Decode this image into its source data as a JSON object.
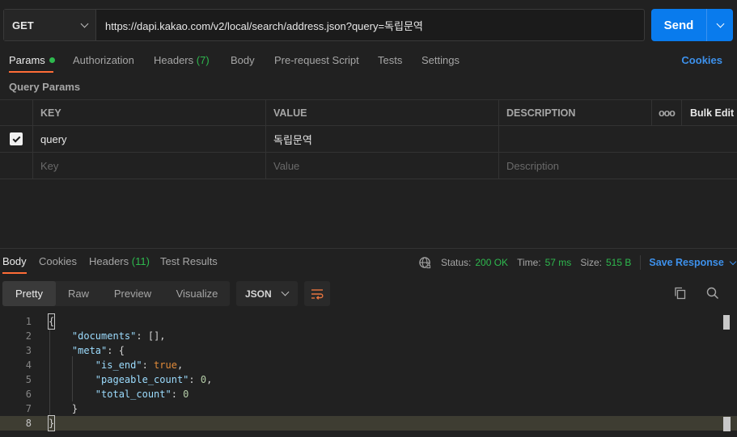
{
  "request": {
    "method": "GET",
    "url": "https://dapi.kakao.com/v2/local/search/address.json?query=독립문역",
    "send_label": "Send"
  },
  "req_tabs": {
    "params": "Params",
    "authorization": "Authorization",
    "headers": "Headers",
    "headers_count": "(7)",
    "body": "Body",
    "prerequest": "Pre-request Script",
    "tests": "Tests",
    "settings": "Settings",
    "cookies": "Cookies"
  },
  "query_params": {
    "title": "Query Params",
    "columns": {
      "key": "KEY",
      "value": "VALUE",
      "description": "DESCRIPTION",
      "more": "ooo",
      "bulk_edit": "Bulk Edit"
    },
    "rows": [
      {
        "checked": true,
        "key": "query",
        "value": "독립문역",
        "description": ""
      }
    ],
    "placeholders": {
      "key": "Key",
      "value": "Value",
      "description": "Description"
    }
  },
  "response": {
    "tabs": {
      "body": "Body",
      "cookies": "Cookies",
      "headers": "Headers",
      "headers_count": "(11)",
      "test_results": "Test Results"
    },
    "status_label": "Status:",
    "status_value": "200 OK",
    "time_label": "Time:",
    "time_value": "57 ms",
    "size_label": "Size:",
    "size_value": "515 B",
    "save_response": "Save Response",
    "views": {
      "pretty": "Pretty",
      "raw": "Raw",
      "preview": "Preview",
      "visualize": "Visualize"
    },
    "format": "JSON",
    "code_lines": [
      "1",
      "2",
      "3",
      "4",
      "5",
      "6",
      "7",
      "8"
    ],
    "json": {
      "open_brace": "{",
      "documents_key": "\"documents\"",
      "documents_val": "[]",
      "meta_key": "\"meta\"",
      "is_end_key": "\"is_end\"",
      "is_end_val": "true",
      "pageable_count_key": "\"pageable_count\"",
      "pageable_count_val": "0",
      "total_count_key": "\"total_count\"",
      "total_count_val": "0",
      "close_inner": "}",
      "close_brace": "}"
    }
  },
  "colors": {
    "accent_orange": "#ff6c37",
    "send_blue": "#097bed",
    "link_blue": "#3d91ec",
    "status_green": "#2eb94e"
  },
  "icons": [
    "chevron-down-icon",
    "check-icon",
    "globe-icon",
    "wrap-lines-icon",
    "copy-icon",
    "search-icon"
  ]
}
